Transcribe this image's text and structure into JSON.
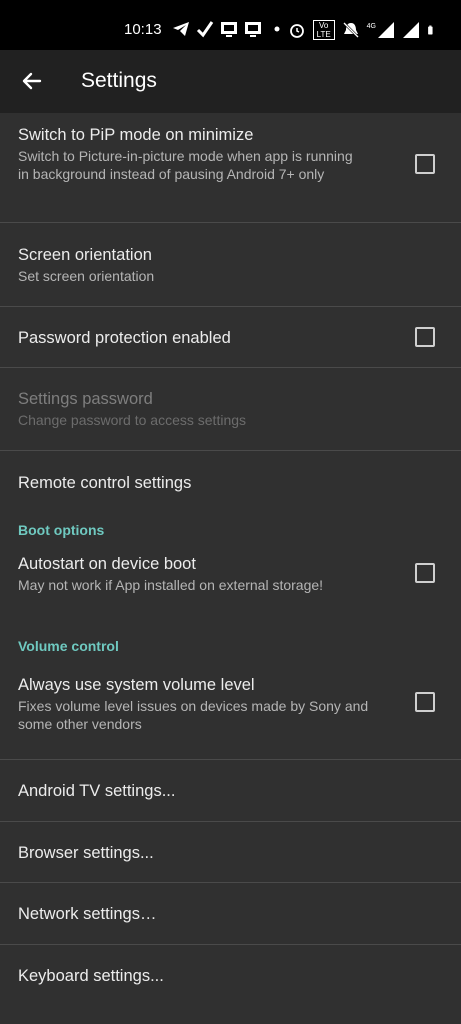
{
  "status_bar": {
    "time": "10:13",
    "icons": [
      "telegram-icon",
      "check-icon",
      "screencast-icon",
      "screencast-icon",
      "dot-icon"
    ],
    "right_icons": [
      "alarm-icon",
      "volte-icon",
      "mute-icon",
      "signal-4g-icon",
      "signal-icon",
      "battery-icon"
    ],
    "network_label": "4G",
    "volte_label": "Vo LTE"
  },
  "app_bar": {
    "title": "Settings",
    "back_icon": "arrow-back-icon"
  },
  "accent_color": "#6fc9c0",
  "preferences": [
    {
      "title": "Switch to PiP mode on minimize",
      "summary": "Switch to Picture-in-picture mode when app is running in background instead of pausing Android 7+ only",
      "checkbox": true,
      "checked": false
    },
    {
      "title": "Screen orientation",
      "summary": "Set screen orientation"
    },
    {
      "title": "Password protection enabled",
      "checkbox": true,
      "checked": false
    },
    {
      "title": "Settings password",
      "summary": "Change password to access settings",
      "enabled": false
    },
    {
      "title": "Remote control settings"
    }
  ],
  "boot_options": {
    "category": "Boot options",
    "items": [
      {
        "title": "Autostart on device boot",
        "summary": "May not work if App installed on external storage!",
        "checkbox": true,
        "checked": false
      }
    ]
  },
  "volume_control": {
    "category": "Volume control",
    "items": [
      {
        "title": "Always use system volume level",
        "summary": "Fixes volume level issues on devices made by Sony and some other vendors",
        "checkbox": true,
        "checked": false
      }
    ]
  },
  "more_settings": [
    {
      "title": "Android TV settings..."
    },
    {
      "title": "Browser settings..."
    },
    {
      "title": "Network settings…"
    },
    {
      "title": "Keyboard settings..."
    }
  ]
}
